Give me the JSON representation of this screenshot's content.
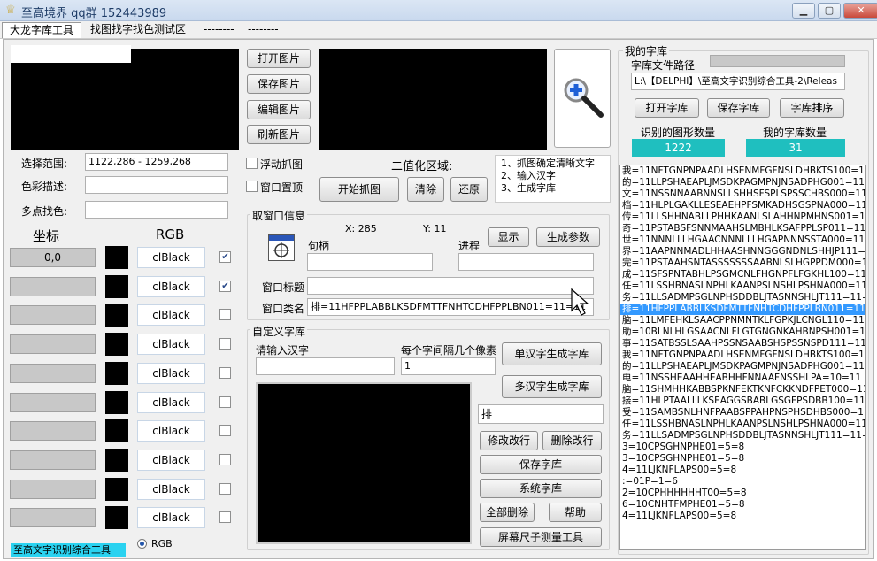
{
  "window": {
    "title": "至高境界  qq群 152443989",
    "minimize": "▁",
    "maximize": "▢",
    "close": "✕"
  },
  "menu": [
    "大龙字库工具",
    "找图找字找色测试区",
    "--------",
    "--------"
  ],
  "buttons": {
    "open_image": "打开图片",
    "save_image": "保存图片",
    "edit_image": "编辑图片",
    "refresh_image": "刷新图片",
    "start_capture": "开始抓图",
    "clear": "清除",
    "restore": "还原",
    "show": "显示",
    "gen_params": "生成参数",
    "open_lib": "打开字库",
    "save_lib": "保存字库",
    "sort_lib": "字库排序",
    "single_gen": "单汉字生成字库",
    "multi_gen": "多汉字生成字库",
    "modify_line": "修改改行",
    "delete_line": "删除改行",
    "save_lib2": "保存字库",
    "system_lib": "系统字库",
    "delete_all": "全部删除",
    "help": "帮助",
    "ruler": "屏幕尺子测量工具"
  },
  "left": {
    "range_label": "选择范围:",
    "range_value": "1122,286 - 1259,268",
    "color_desc_label": "色彩描述:",
    "multi_color_label": "多点找色:",
    "coord_header": "坐标",
    "rgb_header": "RGB",
    "rows": [
      {
        "coord": "0,0",
        "color": "clBlack",
        "checked": true
      },
      {
        "coord": "",
        "color": "clBlack",
        "checked": true
      },
      {
        "coord": "",
        "color": "clBlack",
        "checked": false
      },
      {
        "coord": "",
        "color": "clBlack",
        "checked": false
      },
      {
        "coord": "",
        "color": "clBlack",
        "checked": false
      },
      {
        "coord": "",
        "color": "clBlack",
        "checked": false
      },
      {
        "coord": "",
        "color": "clBlack",
        "checked": false
      },
      {
        "coord": "",
        "color": "clBlack",
        "checked": false
      },
      {
        "coord": "",
        "color": "clBlack",
        "checked": false
      },
      {
        "coord": "",
        "color": "clBlack",
        "checked": false
      }
    ],
    "rgb_radio": "RGB"
  },
  "middle": {
    "float_capture": "浮动抓图",
    "window_top": "窗口置顶",
    "binarize": "二值化区域:",
    "steps": [
      "1、抓图确定清晰文字",
      "2、输入汉字",
      "3、生成字库"
    ],
    "wininfo_title": "取窗口信息",
    "x_label": "X: 285",
    "y_label": "Y: 11",
    "handle_label": "句柄",
    "process_label": "进程",
    "wintitle_label": "窗口标题",
    "winclass_label": "窗口类名",
    "winclass_value": "排=11HFPPLABBLKSDFMTTFNHTCDHFPPLBN011=11=11"
  },
  "custom": {
    "title": "自定义字库",
    "input_label": "请输入汉字",
    "spacing_label": "每个字间隔几个像素",
    "spacing_value": "1",
    "char_value": "排"
  },
  "mylib": {
    "title": "我的字库",
    "path_label": "字库文件路径",
    "path_value": "L:\\【DELPHI】\\至高文字识别综合工具-2\\Releas",
    "recognized_label": "识别的图形数量",
    "recognized_value": "1222",
    "count_label": "我的字库数量",
    "count_value": "31",
    "lines": [
      "我=11NFTGNPNPAADLHSENMFGFNSLDHBKTS100=11=1",
      "的=11LLPSHAEAPLJMSDKPAGMPNJNSADPHG001=11=1",
      "文=11NSSNNAABNNSLLSHHSFSPLSPSSCHBS000=11=1",
      "档=11HLPLGAKLLESEAEHPFSMKADHSGSPNA000=11=1",
      "传=11LLSHHNABLLPHHKAANLSLAHHNPMHNS001=11=1",
      "奇=11PSTABSFSNNMAAHSLMBHLKSAFPPLSP011=11=1",
      "世=11NNNLLLHGAACNNNLLLHGAPNNNSSTA000=11=1",
      "界=11AAPNNMADLHHAASHNNGGGNDNLSHHJP111=11=1",
      "完=11PSTAAHSNTASSSSSSSAABNLSLHGPPDM000=11=1",
      "成=11SFSPNTABHLPSGMCNLFHGNPFLFGKHL100=11=1",
      "任=11LSSHBNASLNPHLKAANPSLNSHLPSHNA000=11=1",
      "务=11LLSADMPSGLNPHSDDBLJTASNNSHLJT111=11=1",
      "排=11HFPPLABBLKSDFMTTFNHTCDHFPPLBN011=11=11",
      "脑=11LMFEHKLSAACPPNMNTKLFGPKJLCNGL110=11=1",
      "助=10BLNLHLGSAACNLFLGTGNGNKAHBNPSH001=11=1",
      "事=11SATBSSLSAAHPSSNSAABSHSPSSNSPD111=11=1",
      "我=11NFTGNPNPAADLHSENMFGFNSLDHBKTS100=11=1",
      "的=11LLPSHAEAPLJMSDKPAGMPNJNSADPHG001=11=1",
      "电=11NSSHEAAHHEABHHFNNAAFNSSHLPA=10=11",
      "脑=11SHMHHKABBSPKNFEKTKNFCKKNDFPET000=11=1",
      "接=11HLPTAALLLKSEAGGSBABLGSGFPSDBB100=11=1",
      "受=11SAMBSNLHNFPAABSPPAHPNSPHSDHBS000=11=1",
      "任=11LSSHBNASLNPHLKAANPSLNSHLPSHNA000=11=1",
      "务=11LLSADMPSGLNPHSDDBLJTASNNSHLJT111=11=1",
      "3=10CPSGHNPHE01=5=8",
      "3=10CPSGHNPHE01=5=8",
      "4=11LJKNFLAPS00=5=8",
      ":=01P=1=6",
      "2=10CPHHHHHHT00=5=8",
      "6=10CNHTFMPHE01=5=8",
      "4=11LJKNFLAPS00=5=8"
    ],
    "selected": 12
  },
  "status": "至高文字识别综合工具"
}
